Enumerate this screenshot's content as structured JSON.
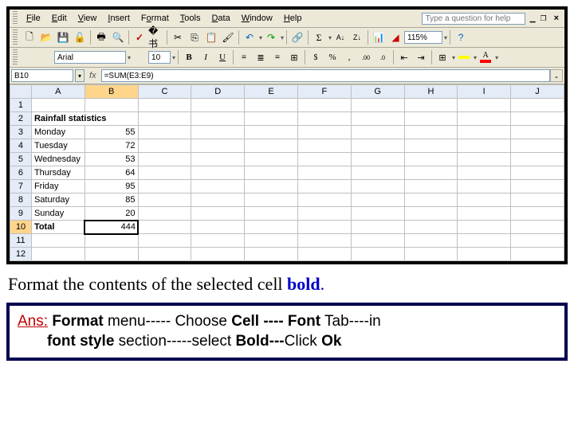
{
  "menu": {
    "items": [
      "File",
      "Edit",
      "View",
      "Insert",
      "Format",
      "Tools",
      "Data",
      "Window",
      "Help"
    ],
    "help_placeholder": "Type a question for help"
  },
  "toolbar": {
    "zoom": "115%"
  },
  "format": {
    "font_name": "Arial",
    "font_size": "10"
  },
  "formula_bar": {
    "cell_ref": "B10",
    "formula": "=SUM(E3:E9)",
    "fx": "fx"
  },
  "columns": [
    "A",
    "B",
    "C",
    "D",
    "E",
    "F",
    "G",
    "H",
    "I",
    "J"
  ],
  "rows": [
    "1",
    "2",
    "3",
    "4",
    "5",
    "6",
    "7",
    "8",
    "9",
    "10",
    "11",
    "12"
  ],
  "cells": {
    "A2": "Rainfall statistics",
    "A3": "Monday",
    "B3": "55",
    "A4": "Tuesday",
    "B4": "72",
    "A5": "Wednesday",
    "B5": "53",
    "A6": "Thursday",
    "B6": "64",
    "A7": "Friday",
    "B7": "95",
    "A8": "Saturday",
    "B8": "85",
    "A9": "Sunday",
    "B9": "20",
    "A10": "Total",
    "B10": "444"
  },
  "instruction": {
    "text": "Format the contents of the selected cell ",
    "bold_word": "bold",
    "period": "."
  },
  "answer": {
    "label": "Ans:",
    "p1": " ",
    "b1": "Format",
    " p2": " menu----- Choose ",
    "b2": "Cell ---- Font",
    " p3": " Tab----in ",
    "b3": "font style",
    " p4": " section-----select ",
    "b4": "Bold---",
    " p5": "Click ",
    "b5": "Ok"
  }
}
